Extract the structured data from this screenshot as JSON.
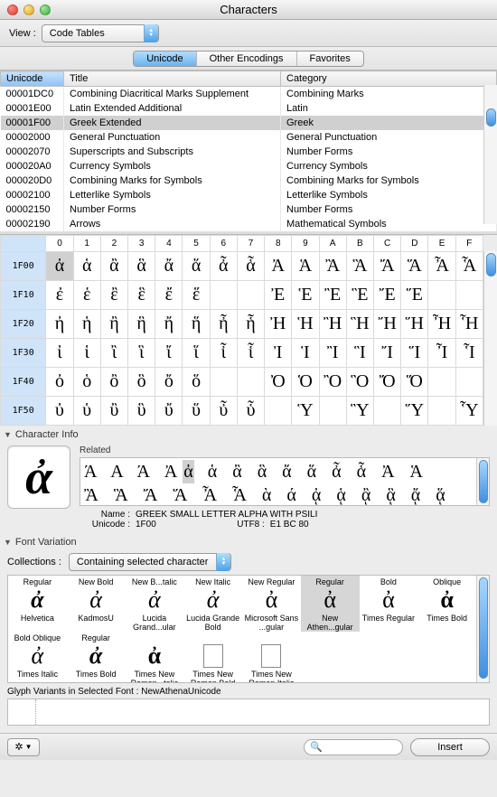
{
  "window": {
    "title": "Characters"
  },
  "toolbar": {
    "view_label": "View :",
    "view_value": "Code Tables"
  },
  "tabs": {
    "items": [
      "Unicode",
      "Other Encodings",
      "Favorites"
    ],
    "selected": 0
  },
  "list": {
    "columns": [
      "Unicode",
      "Title",
      "Category"
    ],
    "sort_col": 0,
    "selected": 2,
    "rows": [
      {
        "code": "00001DC0",
        "title": "Combining Diacritical Marks Supplement",
        "category": "Combining Marks"
      },
      {
        "code": "00001E00",
        "title": "Latin Extended Additional",
        "category": "Latin"
      },
      {
        "code": "00001F00",
        "title": "Greek Extended",
        "category": "Greek"
      },
      {
        "code": "00002000",
        "title": "General Punctuation",
        "category": "General Punctuation"
      },
      {
        "code": "00002070",
        "title": "Superscripts and Subscripts",
        "category": "Number Forms"
      },
      {
        "code": "000020A0",
        "title": "Currency Symbols",
        "category": "Currency Symbols"
      },
      {
        "code": "000020D0",
        "title": "Combining Marks for Symbols",
        "category": "Combining Marks for Symbols"
      },
      {
        "code": "00002100",
        "title": "Letterlike Symbols",
        "category": "Letterlike Symbols"
      },
      {
        "code": "00002150",
        "title": "Number Forms",
        "category": "Number Forms"
      },
      {
        "code": "00002190",
        "title": "Arrows",
        "category": "Mathematical Symbols"
      }
    ]
  },
  "grid": {
    "col_headers": [
      "0",
      "1",
      "2",
      "3",
      "4",
      "5",
      "6",
      "7",
      "8",
      "9",
      "A",
      "B",
      "C",
      "D",
      "E",
      "F"
    ],
    "row_headers": [
      "1F00",
      "1F10",
      "1F20",
      "1F30",
      "1F40",
      "1F50"
    ],
    "selected": {
      "row": 0,
      "col": 0
    },
    "cells": [
      [
        "ἀ",
        "ἁ",
        "ἂ",
        "ἃ",
        "ἄ",
        "ἅ",
        "ἆ",
        "ἇ",
        "Ἀ",
        "Ἁ",
        "Ἂ",
        "Ἃ",
        "Ἄ",
        "Ἅ",
        "Ἆ",
        "Ἇ"
      ],
      [
        "ἐ",
        "ἑ",
        "ἒ",
        "ἓ",
        "ἔ",
        "ἕ",
        "",
        "",
        "Ἐ",
        "Ἑ",
        "Ἒ",
        "Ἓ",
        "Ἔ",
        "Ἕ",
        "",
        ""
      ],
      [
        "ἠ",
        "ἡ",
        "ἢ",
        "ἣ",
        "ἤ",
        "ἥ",
        "ἦ",
        "ἧ",
        "Ἠ",
        "Ἡ",
        "Ἢ",
        "Ἣ",
        "Ἤ",
        "Ἥ",
        "Ἦ",
        "Ἧ"
      ],
      [
        "ἰ",
        "ἱ",
        "ἲ",
        "ἳ",
        "ἴ",
        "ἵ",
        "ἶ",
        "ἷ",
        "Ἰ",
        "Ἱ",
        "Ἲ",
        "Ἳ",
        "Ἴ",
        "Ἵ",
        "Ἶ",
        "Ἷ"
      ],
      [
        "ὀ",
        "ὁ",
        "ὂ",
        "ὃ",
        "ὄ",
        "ὅ",
        "",
        "",
        "Ὀ",
        "Ὁ",
        "Ὂ",
        "Ὃ",
        "Ὄ",
        "Ὅ",
        "",
        ""
      ],
      [
        "ὐ",
        "ὑ",
        "ὒ",
        "ὓ",
        "ὔ",
        "ὕ",
        "ὖ",
        "ὗ",
        "",
        "Ὑ",
        "",
        "Ὓ",
        "",
        "Ὕ",
        "",
        "Ὗ"
      ]
    ]
  },
  "charinfo": {
    "section": "Character Info",
    "related_label": "Related",
    "preview_char": "ἀ",
    "related_row1": [
      "Ά",
      "Α",
      "Ά",
      "Ἀ"
    ],
    "related_sel": "ἀ",
    "related_row1b": [
      "ἁ",
      "ἂ",
      "ἃ",
      "ἄ",
      "ἅ",
      "ἆ",
      "ἇ",
      "Ἀ",
      "Ἁ"
    ],
    "related_row2": [
      "Ἂ",
      "Ἃ",
      "Ἄ",
      "Ἅ",
      "Ἆ",
      "Ἇ",
      "ὰ",
      "ά",
      "ᾀ",
      "ᾁ",
      "ᾂ",
      "ᾃ",
      "ᾄ",
      "ᾅ"
    ],
    "name_label": "Name :",
    "name_value": "GREEK SMALL LETTER ALPHA WITH PSILI",
    "unicode_label": "Unicode :",
    "unicode_value": "1F00",
    "utf8_label": "UTF8 :",
    "utf8_value": "E1 BC 80"
  },
  "fontvar": {
    "section": "Font Variation",
    "collections_label": "Collections :",
    "collections_value": "Containing selected character",
    "selected": 5,
    "fonts_row1": [
      {
        "style": "Regular",
        "name": "Helvetica",
        "glyph": "ἀ",
        "bold": true,
        "italic": true
      },
      {
        "style": "New Bold",
        "name": "KadmosU",
        "glyph": "ἀ",
        "italic": true
      },
      {
        "style": "New B...talic",
        "name": "Lucida Grand...ular",
        "glyph": "ἀ",
        "italic": true
      },
      {
        "style": "New Italic",
        "name": "Lucida Grande Bold",
        "glyph": "ἀ",
        "italic": true
      },
      {
        "style": "New Regular",
        "name": "Microsoft Sans ...gular",
        "glyph": "ἀ"
      },
      {
        "style": "Regular",
        "name": "New Athen...gular",
        "glyph": "ἀ"
      },
      {
        "style": "Bold",
        "name": "Times Regular",
        "glyph": "ἀ"
      },
      {
        "style": "Oblique",
        "name": "Times Bold",
        "glyph": "ἀ",
        "bold": true
      }
    ],
    "fonts_row2": [
      {
        "style": "Bold Oblique",
        "name": "Times Italic",
        "glyph": "ἀ",
        "italic": true
      },
      {
        "style": "Regular",
        "name": "Times Bold",
        "glyph": "ἀ",
        "bold": true,
        "italic": true
      },
      {
        "style": "",
        "name": "Times New Roman...talic",
        "glyph": "ἀ",
        "bold": true
      },
      {
        "style": "",
        "name": "Times New Roman Bold",
        "glyph": "",
        "empty": true
      },
      {
        "style": "",
        "name": "Times New Roman Italic",
        "glyph": "",
        "empty": true
      }
    ]
  },
  "glyph_variants": {
    "label": "Glyph Variants in Selected Font :",
    "font": "NewAthenaUnicode"
  },
  "footer": {
    "insert_label": "Insert",
    "search_placeholder": ""
  }
}
